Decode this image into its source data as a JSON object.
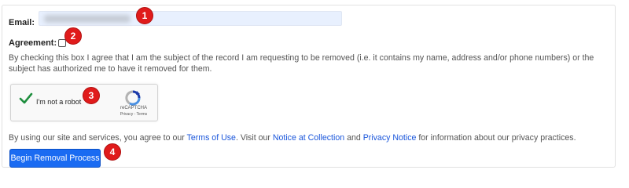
{
  "form": {
    "email_label": "Email:",
    "email_value": "",
    "agreement_label": "Agreement:",
    "agreement_checked": false,
    "disclaimer": "By checking this box I agree that I am the subject of the record I am requesting to be removed (i.e. it contains my name, address and/or phone numbers) or the subject has authorized me to have it removed for them.",
    "recaptcha": {
      "label": "I'm not a robot",
      "brand": "reCAPTCHA",
      "links": "Privacy - Terms",
      "checked": true
    },
    "terms": {
      "prefix": "By using our site and services, you agree to our ",
      "terms_link": "Terms of Use",
      "middle": ". Visit our ",
      "notice_link": "Notice at Collection",
      "and": " and ",
      "privacy_link": "Privacy Notice",
      "suffix": " for information about our privacy practices."
    },
    "submit_label": "Begin Removal Process"
  },
  "badges": [
    "1",
    "2",
    "3",
    "4"
  ],
  "colors": {
    "accent": "#1a6bf2",
    "badge": "#e01b1b",
    "link": "#1a56db",
    "check": "#1e8e3e"
  }
}
